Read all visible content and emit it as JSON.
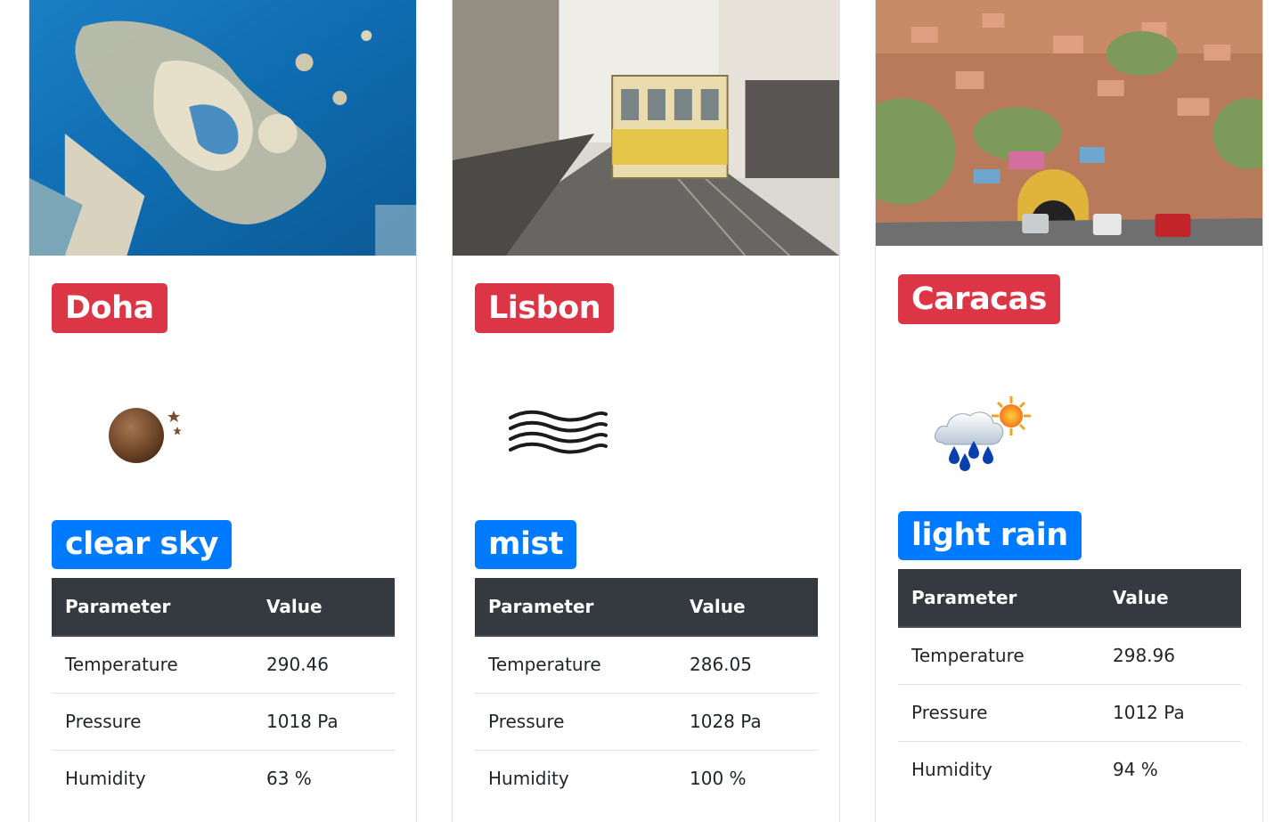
{
  "table_headers": {
    "parameter": "Parameter",
    "value": "Value"
  },
  "cities": [
    {
      "name": "Doha",
      "description": "clear sky",
      "icon": "clear-night-icon",
      "rows": [
        {
          "label": "Temperature",
          "value": "290.46"
        },
        {
          "label": "Pressure",
          "value": "1018 Pa"
        },
        {
          "label": "Humidity",
          "value": "63 %"
        }
      ]
    },
    {
      "name": "Lisbon",
      "description": "mist",
      "icon": "mist-icon",
      "rows": [
        {
          "label": "Temperature",
          "value": "286.05"
        },
        {
          "label": "Pressure",
          "value": "1028 Pa"
        },
        {
          "label": "Humidity",
          "value": "100 %"
        }
      ]
    },
    {
      "name": "Caracas",
      "description": "light rain",
      "icon": "light-rain-icon",
      "rows": [
        {
          "label": "Temperature",
          "value": "298.96"
        },
        {
          "label": "Pressure",
          "value": "1012 Pa"
        },
        {
          "label": "Humidity",
          "value": "94 %"
        }
      ]
    }
  ],
  "colors": {
    "city_badge": "#dc3545",
    "description_badge": "#007bff",
    "table_header": "#343a40"
  }
}
